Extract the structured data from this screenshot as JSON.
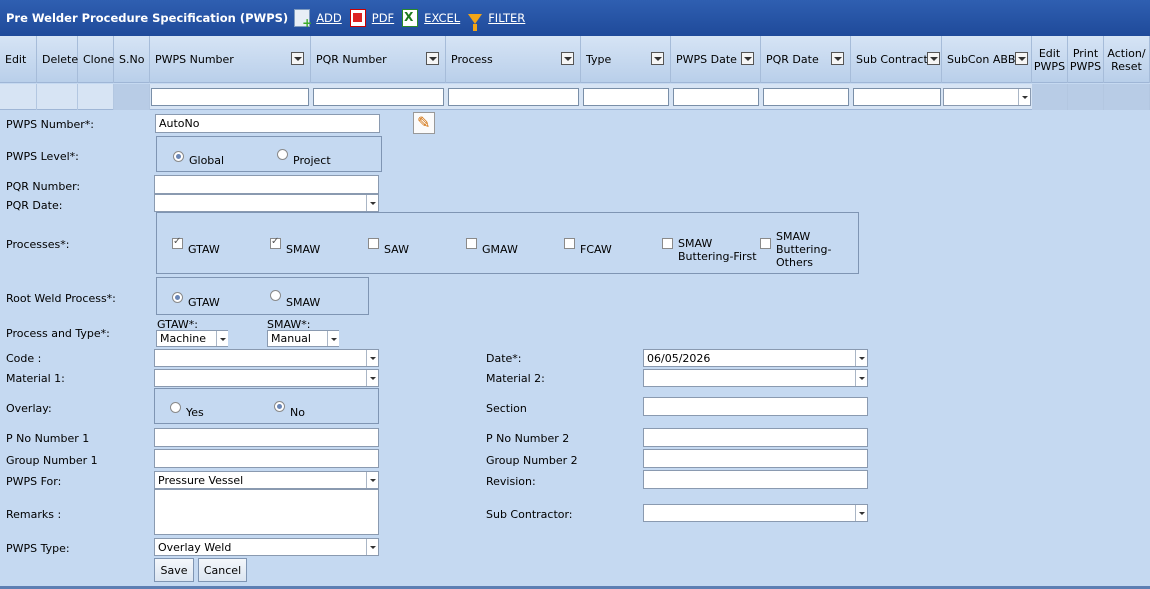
{
  "toolbar": {
    "title": "Pre Welder Procedure Specification (PWPS)",
    "add": "ADD",
    "pdf": "PDF",
    "excel": "EXCEL",
    "filter": "FILTER"
  },
  "grid": {
    "columns": [
      "Edit",
      "Delete",
      "Clone",
      "S.No",
      "PWPS Number",
      "PQR Number",
      "Process",
      "Type",
      "PWPS Date",
      "PQR Date",
      "Sub Contractor",
      "SubCon ABBR",
      "Edit PWPS",
      "Print PWPS",
      "Action/ Reset"
    ]
  },
  "form": {
    "pwps_number_label": "PWPS Number*:",
    "pwps_number_value": "AutoNo",
    "pwps_level_label": "PWPS Level*:",
    "level_global": "Global",
    "level_project": "Project",
    "pqr_number_label": "PQR Number:",
    "pqr_date_label": "PQR Date:",
    "processes_label": "Processes*:",
    "proc_gtaw": "GTAW",
    "proc_smaw": "SMAW",
    "proc_saw": "SAW",
    "proc_gmaw": "GMAW",
    "proc_fcaw": "FCAW",
    "proc_smaw_bf_1": "SMAW",
    "proc_smaw_bf_2": "Buttering-First",
    "proc_smaw_bo_1": "SMAW",
    "proc_smaw_bo_2": "Buttering-",
    "proc_smaw_bo_3": "Others",
    "root_label": "Root Weld Process*:",
    "root_gtaw": "GTAW",
    "root_smaw": "SMAW",
    "pt_label": "Process and Type*:",
    "pt_gtaw_label": "GTAW*:",
    "pt_gtaw_value": "Machine",
    "pt_smaw_label": "SMAW*:",
    "pt_smaw_value": "Manual",
    "code_label": "Code :",
    "material1_label": "Material 1:",
    "overlay_label": "Overlay:",
    "overlay_yes": "Yes",
    "overlay_no": "No",
    "pno1_label": "P No Number 1",
    "group1_label": "Group Number 1",
    "pwps_for_label": "PWPS For:",
    "pwps_for_value": "Pressure Vessel",
    "remarks_label": "Remarks :",
    "pwps_type_label": "PWPS Type:",
    "pwps_type_value": "Overlay Weld",
    "date_label": "Date*:",
    "date_value": "06/05/2026",
    "material2_label": "Material 2:",
    "section_label": "Section",
    "pno2_label": "P No Number 2",
    "group2_label": "Group Number 2",
    "revision_label": "Revision:",
    "subcontractor_label": "Sub Contractor:",
    "save": "Save",
    "cancel": "Cancel"
  }
}
